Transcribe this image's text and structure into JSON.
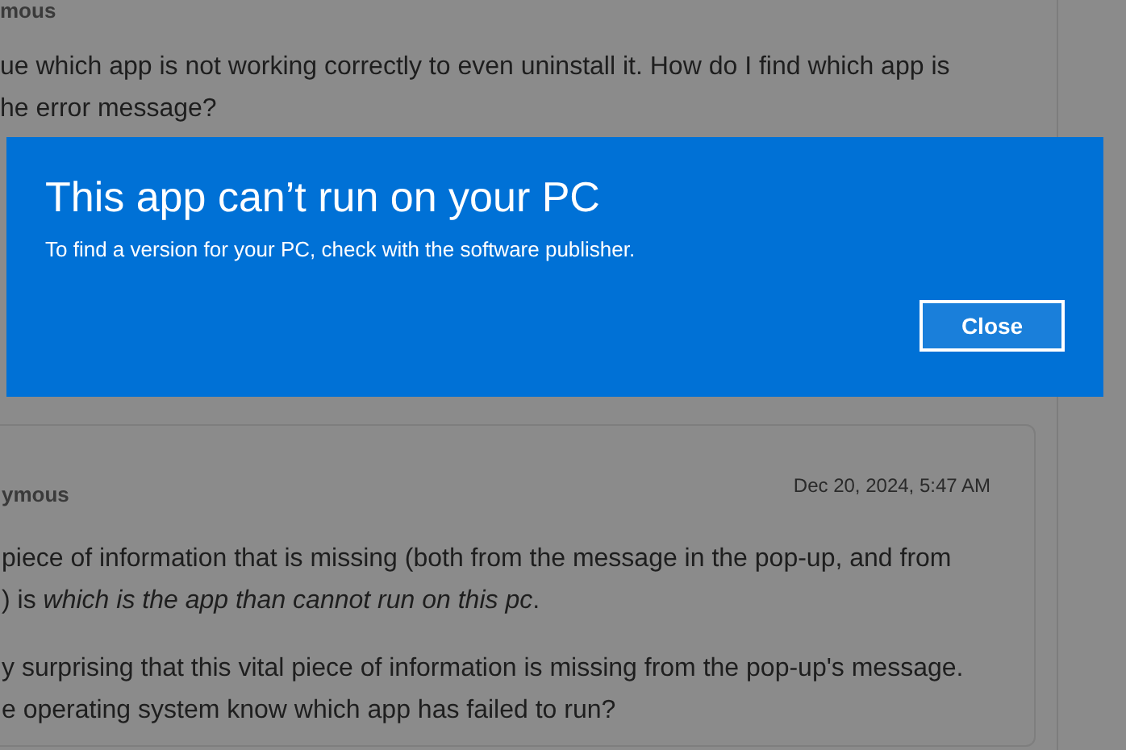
{
  "background_page": {
    "first_post": {
      "author": "mous",
      "lines": [
        "ue which app is not working correctly to even uninstall it. How do I find which app is",
        "he error message?"
      ]
    },
    "second_post": {
      "author": "ymous",
      "date": "Dec 20, 2024, 5:47 AM",
      "paragraphs": [
        [
          "piece of information that is missing (both from the message in the pop-up, and from",
          ") is *which is the app than cannot run on this pc*."
        ],
        [
          "y surprising that this vital piece of information is missing from the pop-up's message.",
          "e operating system know which app has failed to run?"
        ]
      ]
    }
  },
  "dialog": {
    "title": "This app can’t run on your PC",
    "message": "To find a version for your PC, check with the software publisher.",
    "buttons": [
      {
        "label": "Close"
      }
    ]
  }
}
